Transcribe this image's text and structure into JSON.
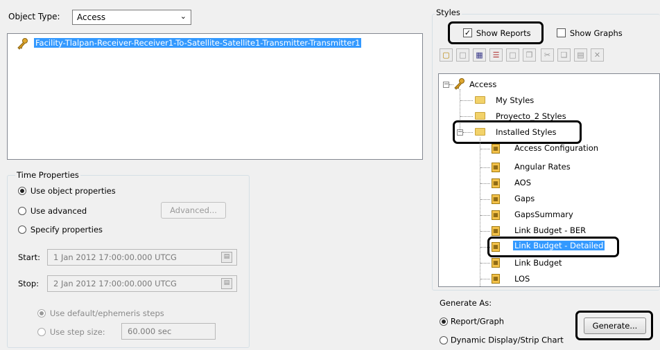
{
  "object_type": {
    "label": "Object Type:",
    "value": "Access"
  },
  "object_list": {
    "items": [
      "Facility-Tlalpan-Receiver-Receiver1-To-Satellite-Satellite1-Transmitter-Transmitter1"
    ]
  },
  "time_properties": {
    "title": "Time Properties",
    "use_object": "Use object properties",
    "use_advanced": "Use advanced",
    "advanced_button": "Advanced...",
    "specify": "Specify properties",
    "start_label": "Start:",
    "start_value": "1 Jan 2012 17:00:00.000 UTCG",
    "stop_label": "Stop:",
    "stop_value": "2 Jan 2012 17:00:00.000 UTCG",
    "default_steps": "Use default/ephemeris steps",
    "step_size_label": "Use step size:",
    "step_size_value": "60.000 sec"
  },
  "styles": {
    "title": "Styles",
    "show_reports": "Show Reports",
    "show_graphs": "Show Graphs",
    "tree": {
      "root": "Access",
      "my_styles": "My Styles",
      "proyecto": "Proyecto_2 Styles",
      "installed": "Installed Styles",
      "items": [
        "Access Configuration",
        "Angular Rates",
        "AOS",
        "Gaps",
        "GapsSummary",
        "Link Budget - BER",
        "Link Budget - Detailed",
        "Link Budget",
        "LOS"
      ]
    }
  },
  "generate_as": {
    "title": "Generate As:",
    "report_graph": "Report/Graph",
    "dynamic": "Dynamic Display/Strip Chart",
    "generate_button": "Generate..."
  }
}
